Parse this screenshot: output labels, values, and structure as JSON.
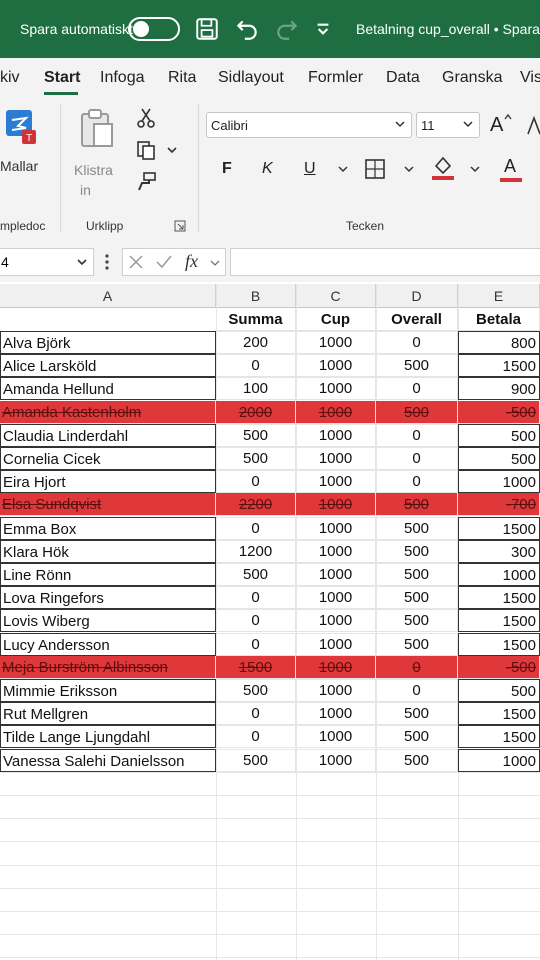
{
  "titlebar": {
    "autosave_label": "Spara automatiskt",
    "doc_title": "Betalning cup_overall • Spara"
  },
  "tabs": [
    "kiv",
    "Start",
    "Infoga",
    "Rita",
    "Sidlayout",
    "Formler",
    "Data",
    "Granska",
    "Vis"
  ],
  "active_tab": "Start",
  "ribbon": {
    "templates_label": "Mallar",
    "paste_label": "Klistra",
    "paste_sub": "in",
    "group_templates": "mpledoc",
    "group_clipboard": "Urklipp",
    "group_font": "Tecken",
    "font_name": "Calibri",
    "font_size": "11",
    "grow_font": "A",
    "bold": "F",
    "italic": "K",
    "underline": "U",
    "font_color_letter": "A"
  },
  "formula_bar": {
    "name_box": "4",
    "fx": "fx"
  },
  "columns": [
    "A",
    "B",
    "C",
    "D",
    "E"
  ],
  "headers": {
    "summa": "Summa",
    "cup": "Cup",
    "overall": "Overall",
    "betala": "Betala"
  },
  "rows": [
    {
      "name": "Alva Björk",
      "summa": "200",
      "cup": "1000",
      "overall": "0",
      "betala": "800",
      "struck": false
    },
    {
      "name": "Alice Larsköld",
      "summa": "0",
      "cup": "1000",
      "overall": "500",
      "betala": "1500",
      "struck": false
    },
    {
      "name": "Amanda Hellund",
      "summa": "100",
      "cup": "1000",
      "overall": "0",
      "betala": "900",
      "struck": false
    },
    {
      "name": "Amanda Kastenholm",
      "summa": "2000",
      "cup": "1000",
      "overall": "500",
      "betala": "-500",
      "struck": true
    },
    {
      "name": "Claudia Linderdahl",
      "summa": "500",
      "cup": "1000",
      "overall": "0",
      "betala": "500",
      "struck": false
    },
    {
      "name": "Cornelia Cicek",
      "summa": "500",
      "cup": "1000",
      "overall": "0",
      "betala": "500",
      "struck": false
    },
    {
      "name": "Eira Hjort",
      "summa": "0",
      "cup": "1000",
      "overall": "0",
      "betala": "1000",
      "struck": false
    },
    {
      "name": "Elsa Sundqvist",
      "summa": "2200",
      "cup": "1000",
      "overall": "500",
      "betala": "-700",
      "struck": true
    },
    {
      "name": "Emma Box",
      "summa": "0",
      "cup": "1000",
      "overall": "500",
      "betala": "1500",
      "struck": false
    },
    {
      "name": "Klara Hök",
      "summa": "1200",
      "cup": "1000",
      "overall": "500",
      "betala": "300",
      "struck": false
    },
    {
      "name": "Line Rönn",
      "summa": "500",
      "cup": "1000",
      "overall": "500",
      "betala": "1000",
      "struck": false
    },
    {
      "name": "Lova Ringefors",
      "summa": "0",
      "cup": "1000",
      "overall": "500",
      "betala": "1500",
      "struck": false
    },
    {
      "name": "Lovis Wiberg",
      "summa": "0",
      "cup": "1000",
      "overall": "500",
      "betala": "1500",
      "struck": false
    },
    {
      "name": "Lucy Andersson",
      "summa": "0",
      "cup": "1000",
      "overall": "500",
      "betala": "1500",
      "struck": false
    },
    {
      "name": "Meja Burström Albinsson",
      "summa": "1500",
      "cup": "1000",
      "overall": "0",
      "betala": "-500",
      "struck": true
    },
    {
      "name": "Mimmie Eriksson",
      "summa": "500",
      "cup": "1000",
      "overall": "0",
      "betala": "500",
      "struck": false
    },
    {
      "name": "Rut Mellgren",
      "summa": "0",
      "cup": "1000",
      "overall": "500",
      "betala": "1500",
      "struck": false
    },
    {
      "name": "Tilde Lange Ljungdahl",
      "summa": "0",
      "cup": "1000",
      "overall": "500",
      "betala": "1500",
      "struck": false
    },
    {
      "name": "Vanessa Salehi Danielsson",
      "summa": "500",
      "cup": "1000",
      "overall": "500",
      "betala": "1000",
      "struck": false
    }
  ],
  "colors": {
    "excel_green": "#1e6e42",
    "strike_fill": "#e0373a"
  }
}
